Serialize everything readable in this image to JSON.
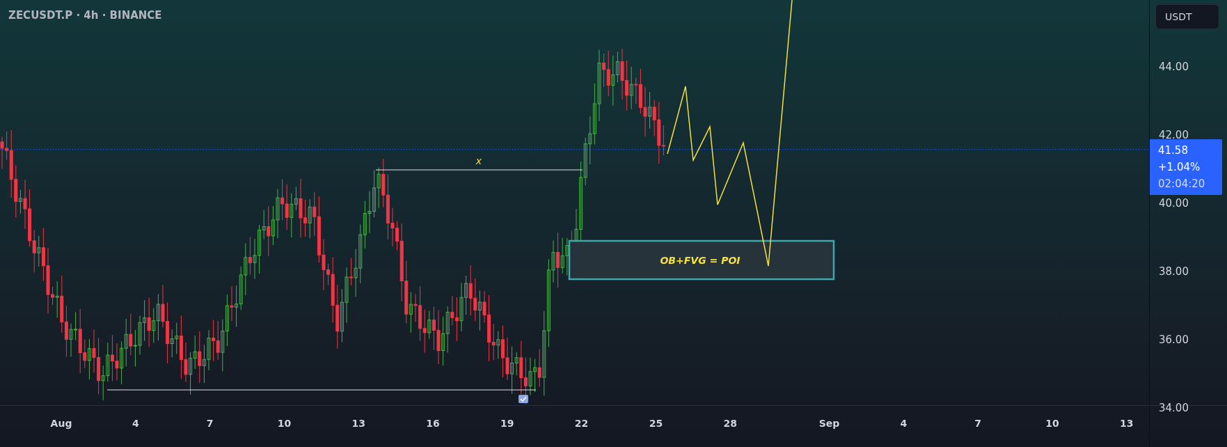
{
  "header": {
    "symbol_line": "ZECUSDT.P · 4h · BINANCE"
  },
  "price_axis": {
    "currency_button": "USDT",
    "labels": [
      "44.00",
      "42.00",
      "40.00",
      "38.00",
      "36.00",
      "34.00"
    ],
    "last_price": {
      "price": "41.58",
      "change": "+1.04%",
      "countdown": "02:04:20"
    }
  },
  "time_axis": {
    "labels": [
      "Aug",
      "4",
      "7",
      "10",
      "13",
      "16",
      "19",
      "22",
      "25",
      "28",
      "Sep",
      "4",
      "7",
      "10",
      "13"
    ]
  },
  "drawings": [
    {
      "kind": "level-line",
      "label": "x"
    },
    {
      "kind": "level-line"
    },
    {
      "kind": "zone",
      "label": "OB+FVG = POI"
    },
    {
      "kind": "projection"
    }
  ]
}
